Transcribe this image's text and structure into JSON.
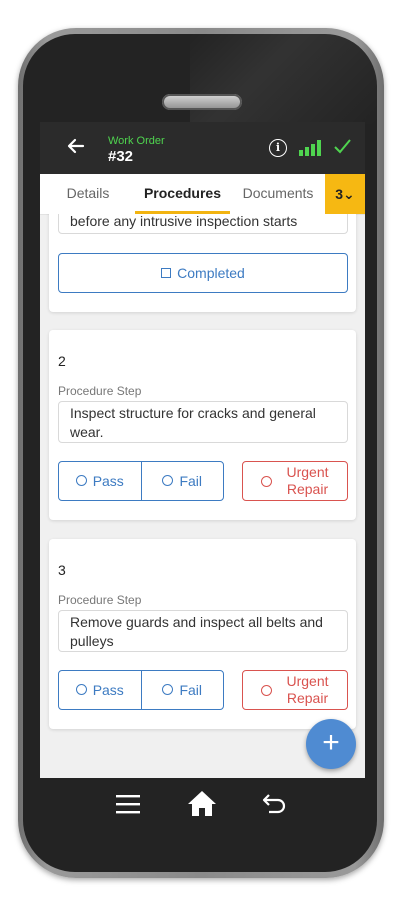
{
  "header": {
    "subtitle": "Work Order",
    "title": "#32",
    "back_icon": "arrow-left-icon",
    "info_label": "i",
    "signal_icon": "signal-bars-icon",
    "sync_icon": "checkmark-icon",
    "accent_color": "#4fd44f"
  },
  "tabs": [
    {
      "label": "Details",
      "active": false
    },
    {
      "label": "Procedures",
      "active": true
    },
    {
      "label": "Documents",
      "active": false
    }
  ],
  "tab_more": {
    "label": "3⌄"
  },
  "card0": {
    "step_text": "before any intrusive inspection starts",
    "completed_label": "Completed"
  },
  "steps": [
    {
      "number": "2",
      "label": "Procedure Step",
      "text": "Inspect structure for cracks and general wear.",
      "pass_label": "Pass",
      "fail_label": "Fail",
      "urgent_line1": "Urgent",
      "urgent_line2": "Repair"
    },
    {
      "number": "3",
      "label": "Procedure Step",
      "text": "Remove guards and inspect all belts and pulleys",
      "pass_label": "Pass",
      "fail_label": "Fail",
      "urgent_line1": "Urgent",
      "urgent_line2": "Repair"
    }
  ],
  "fab": {
    "label": "+",
    "color": "#4f8bd2"
  },
  "nav": {
    "menu_icon": "hamburger-menu-icon",
    "home_icon": "home-icon",
    "back_icon": "return-icon"
  },
  "colors": {
    "primary": "#3d7bc2",
    "danger": "#d9534f",
    "tab_accent": "#f2b411",
    "header_bg": "#2b2b2b"
  }
}
